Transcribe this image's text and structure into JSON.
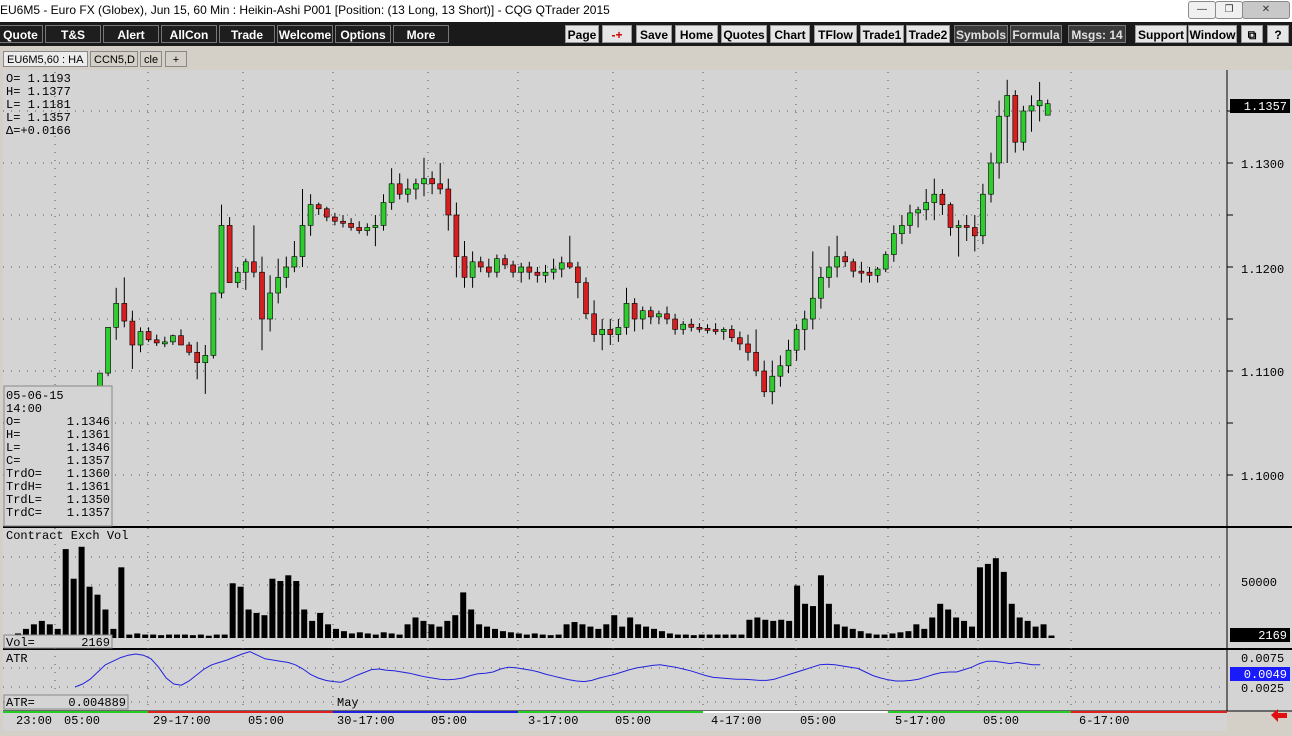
{
  "window": {
    "title": "EU6M5 - Euro FX (Globex), Jun 15, 60 Min : Heikin-Ashi   P001   [Position: (13 Long, 13 Short)] - CQG QTrader 2015"
  },
  "toolbar": {
    "left": [
      "Quote",
      "T&S",
      "Alert",
      "AllCon",
      "Trade",
      "Welcome",
      "Options",
      "More"
    ],
    "right": [
      "Page",
      "-+",
      "Save",
      "Home",
      "Quotes",
      "Chart",
      "TFlow",
      "Trade1",
      "Trade2",
      "Symbols",
      "Formula",
      "Msgs: 14",
      "Support",
      "Window",
      "⧉",
      "?"
    ]
  },
  "tabs": [
    "EU6M5,60 : HA",
    "CCN5,D",
    "cle",
    "+"
  ],
  "ohlc_box": {
    "o": "O=  1.1193",
    "h": "H=  1.1377",
    "l": "L=  1.1181",
    "c": "L=  1.1357",
    "d": "Δ=+0.0166"
  },
  "cursor_box": {
    "date": "05-06-15",
    "time": "14:00",
    "rows": [
      {
        "k": "O=",
        "v": "1.1346"
      },
      {
        "k": "H=",
        "v": "1.1361"
      },
      {
        "k": "L=",
        "v": "1.1346"
      },
      {
        "k": "C=",
        "v": "1.1357"
      },
      {
        "k": "TrdO=",
        "v": "1.1360"
      },
      {
        "k": "TrdH=",
        "v": "1.1361"
      },
      {
        "k": "TrdL=",
        "v": "1.1350"
      },
      {
        "k": "TrdC=",
        "v": "1.1357"
      }
    ]
  },
  "price_axis": {
    "labels": [
      "1.1300",
      "1.1200",
      "1.1100",
      "1.1000"
    ],
    "current": "1.1357"
  },
  "volume": {
    "title": "Contract Exch Vol",
    "label": "Vol=",
    "value": "2169",
    "axis_label": "50000",
    "current": "2169"
  },
  "atr": {
    "title": "ATR",
    "label": "ATR=",
    "value": "0.004889",
    "axis_labels": [
      "0.0075",
      "0.0025"
    ],
    "current": "0.0049"
  },
  "time_axis": {
    "labels": [
      "23:00",
      "05:00",
      "29-17:00",
      "05:00",
      "30-17:00",
      "05:00",
      "3-17:00",
      "05:00",
      "4-17:00",
      "05:00",
      "5-17:00",
      "05:00",
      "6-17:00"
    ],
    "month": "May"
  },
  "colors": {
    "up": "#2ecc2e",
    "down": "#d42020",
    "atr_line": "#2222dd",
    "bg": "#d4d4d4"
  },
  "chart_data": [
    {
      "type": "candlestick",
      "title": "",
      "ylim": [
        1.0985,
        1.1395
      ],
      "x_labels": [
        "23:00",
        "05:00",
        "29-17:00",
        "05:00",
        "30-17:00",
        "05:00",
        "3-17:00",
        "05:00",
        "4-17:00",
        "05:00",
        "5-17:00",
        "05:00",
        "6-17:00"
      ],
      "candles": [
        [
          1.1078,
          1.1098,
          1.1058,
          1.1098
        ],
        [
          1.1098,
          1.1142,
          1.1095,
          1.1142
        ],
        [
          1.1142,
          1.118,
          1.113,
          1.1165
        ],
        [
          1.1165,
          1.119,
          1.1142,
          1.1148
        ],
        [
          1.1148,
          1.1158,
          1.1102,
          1.1125
        ],
        [
          1.1125,
          1.1142,
          1.1118,
          1.1138
        ],
        [
          1.1138,
          1.1142,
          1.1128,
          1.113
        ],
        [
          1.113,
          1.1135,
          1.1124,
          1.1127
        ],
        [
          1.1127,
          1.1133,
          1.1123,
          1.1128
        ],
        [
          1.1128,
          1.1135,
          1.1125,
          1.1134
        ],
        [
          1.1134,
          1.114,
          1.1128,
          1.1125
        ],
        [
          1.1125,
          1.1128,
          1.1115,
          1.1118
        ],
        [
          1.1118,
          1.1128,
          1.1092,
          1.1108
        ],
        [
          1.1108,
          1.1125,
          1.1078,
          1.1115
        ],
        [
          1.1115,
          1.1175,
          1.1112,
          1.1175
        ],
        [
          1.1175,
          1.126,
          1.117,
          1.124
        ],
        [
          1.124,
          1.1248,
          1.1185,
          1.1185
        ],
        [
          1.1185,
          1.12,
          1.118,
          1.1195
        ],
        [
          1.1195,
          1.1208,
          1.1178,
          1.1205
        ],
        [
          1.1205,
          1.124,
          1.119,
          1.1195
        ],
        [
          1.1195,
          1.121,
          1.112,
          1.115
        ],
        [
          1.115,
          1.1192,
          1.1138,
          1.1175
        ],
        [
          1.1175,
          1.1208,
          1.1165,
          1.119
        ],
        [
          1.119,
          1.121,
          1.118,
          1.12
        ],
        [
          1.12,
          1.1225,
          1.1195,
          1.121
        ],
        [
          1.121,
          1.1275,
          1.12,
          1.124
        ],
        [
          1.124,
          1.127,
          1.123,
          1.126
        ],
        [
          1.126,
          1.1262,
          1.125,
          1.1256
        ],
        [
          1.1256,
          1.1258,
          1.1244,
          1.1248
        ],
        [
          1.1248,
          1.1252,
          1.124,
          1.1244
        ],
        [
          1.1244,
          1.125,
          1.1238,
          1.1242
        ],
        [
          1.1242,
          1.1247,
          1.1235,
          1.1238
        ],
        [
          1.1238,
          1.1244,
          1.1232,
          1.1235
        ],
        [
          1.1235,
          1.1242,
          1.123,
          1.1238
        ],
        [
          1.1238,
          1.125,
          1.122,
          1.124
        ],
        [
          1.124,
          1.127,
          1.1235,
          1.1262
        ],
        [
          1.1262,
          1.1295,
          1.1255,
          1.128
        ],
        [
          1.128,
          1.129,
          1.1265,
          1.127
        ],
        [
          1.127,
          1.1285,
          1.1262,
          1.1275
        ],
        [
          1.1275,
          1.1285,
          1.1265,
          1.128
        ],
        [
          1.128,
          1.1305,
          1.1268,
          1.1285
        ],
        [
          1.1285,
          1.1292,
          1.127,
          1.128
        ],
        [
          1.128,
          1.13,
          1.127,
          1.1275
        ],
        [
          1.1275,
          1.1285,
          1.1235,
          1.125
        ],
        [
          1.125,
          1.1262,
          1.119,
          1.121
        ],
        [
          1.121,
          1.1225,
          1.118,
          1.119
        ],
        [
          1.119,
          1.1215,
          1.118,
          1.1205
        ],
        [
          1.1205,
          1.121,
          1.1195,
          1.12
        ],
        [
          1.12,
          1.1208,
          1.119,
          1.1195
        ],
        [
          1.1195,
          1.1212,
          1.119,
          1.1208
        ],
        [
          1.1208,
          1.1212,
          1.1198,
          1.1202
        ],
        [
          1.1202,
          1.1206,
          1.119,
          1.1195
        ],
        [
          1.1195,
          1.1204,
          1.1185,
          1.12
        ],
        [
          1.12,
          1.1205,
          1.1188,
          1.1195
        ],
        [
          1.1195,
          1.12,
          1.1185,
          1.1192
        ],
        [
          1.1192,
          1.1202,
          1.1185,
          1.1195
        ],
        [
          1.1195,
          1.1208,
          1.1188,
          1.1198
        ],
        [
          1.1198,
          1.121,
          1.119,
          1.1204
        ],
        [
          1.1204,
          1.123,
          1.1198,
          1.12
        ],
        [
          1.12,
          1.1205,
          1.117,
          1.1185
        ],
        [
          1.1185,
          1.119,
          1.115,
          1.1155
        ],
        [
          1.1155,
          1.1168,
          1.1128,
          1.1135
        ],
        [
          1.1135,
          1.115,
          1.112,
          1.114
        ],
        [
          1.114,
          1.115,
          1.1125,
          1.1135
        ],
        [
          1.1135,
          1.115,
          1.1128,
          1.1142
        ],
        [
          1.1142,
          1.118,
          1.1135,
          1.1165
        ],
        [
          1.1165,
          1.117,
          1.1138,
          1.115
        ],
        [
          1.115,
          1.1162,
          1.114,
          1.1158
        ],
        [
          1.1158,
          1.1162,
          1.1145,
          1.1152
        ],
        [
          1.1152,
          1.1158,
          1.1145,
          1.1155
        ],
        [
          1.1155,
          1.1162,
          1.1145,
          1.115
        ],
        [
          1.115,
          1.1155,
          1.1135,
          1.114
        ],
        [
          1.114,
          1.1148,
          1.1135,
          1.1145
        ],
        [
          1.1145,
          1.115,
          1.1138,
          1.1142
        ],
        [
          1.1142,
          1.1146,
          1.1137,
          1.1141
        ],
        [
          1.1141,
          1.1145,
          1.1136,
          1.114
        ],
        [
          1.114,
          1.1146,
          1.1135,
          1.1138
        ],
        [
          1.1138,
          1.1142,
          1.113,
          1.114
        ],
        [
          1.114,
          1.1144,
          1.1128,
          1.1132
        ],
        [
          1.1132,
          1.1138,
          1.112,
          1.1126
        ],
        [
          1.1126,
          1.1135,
          1.111,
          1.1118
        ],
        [
          1.1118,
          1.114,
          1.1095,
          1.11
        ],
        [
          1.11,
          1.111,
          1.1075,
          1.108
        ],
        [
          1.108,
          1.111,
          1.1068,
          1.1095
        ],
        [
          1.1095,
          1.1115,
          1.1085,
          1.1105
        ],
        [
          1.1105,
          1.113,
          1.1098,
          1.112
        ],
        [
          1.112,
          1.1145,
          1.111,
          1.114
        ],
        [
          1.114,
          1.1158,
          1.112,
          1.115
        ],
        [
          1.115,
          1.1215,
          1.114,
          1.117
        ],
        [
          1.117,
          1.12,
          1.116,
          1.119
        ],
        [
          1.119,
          1.122,
          1.118,
          1.12
        ],
        [
          1.12,
          1.123,
          1.119,
          1.121
        ],
        [
          1.121,
          1.1215,
          1.12,
          1.1205
        ],
        [
          1.1205,
          1.1208,
          1.119,
          1.1196
        ],
        [
          1.1196,
          1.1205,
          1.1185,
          1.1195
        ],
        [
          1.1195,
          1.12,
          1.1185,
          1.1192
        ],
        [
          1.1192,
          1.12,
          1.1185,
          1.1198
        ],
        [
          1.1198,
          1.1215,
          1.1195,
          1.1212
        ],
        [
          1.1212,
          1.124,
          1.1205,
          1.1232
        ],
        [
          1.1232,
          1.125,
          1.1222,
          1.124
        ],
        [
          1.124,
          1.126,
          1.1232,
          1.1252
        ],
        [
          1.1252,
          1.1258,
          1.1238,
          1.1255
        ],
        [
          1.1255,
          1.1275,
          1.1245,
          1.1262
        ],
        [
          1.1262,
          1.1285,
          1.1245,
          1.127
        ],
        [
          1.127,
          1.1275,
          1.125,
          1.126
        ],
        [
          1.126,
          1.1262,
          1.123,
          1.1238
        ],
        [
          1.1238,
          1.1245,
          1.121,
          1.124
        ],
        [
          1.124,
          1.125,
          1.1225,
          1.1238
        ],
        [
          1.1238,
          1.125,
          1.1215,
          1.123
        ],
        [
          1.123,
          1.128,
          1.1222,
          1.127
        ],
        [
          1.127,
          1.131,
          1.1262,
          1.13
        ],
        [
          1.13,
          1.136,
          1.1285,
          1.1345
        ],
        [
          1.1345,
          1.138,
          1.13,
          1.1365
        ],
        [
          1.1365,
          1.137,
          1.131,
          1.132
        ],
        [
          1.132,
          1.1355,
          1.1312,
          1.135
        ],
        [
          1.135,
          1.1365,
          1.133,
          1.1355
        ],
        [
          1.1355,
          1.1378,
          1.134,
          1.136
        ],
        [
          1.1346,
          1.1361,
          1.1346,
          1.1357
        ]
      ]
    },
    {
      "type": "bar",
      "title": "Contract Exch Vol",
      "ylim": [
        0,
        100000
      ],
      "values": [
        4000,
        8000,
        12000,
        15000,
        12000,
        8000,
        78000,
        52000,
        80000,
        45000,
        38000,
        25000,
        8000,
        62000,
        3000,
        4000,
        3000,
        3000,
        2500,
        3000,
        3000,
        3000,
        2500,
        3000,
        2000,
        3000,
        3000,
        48000,
        45000,
        25000,
        22000,
        20000,
        52000,
        50000,
        55000,
        50000,
        25000,
        15000,
        22000,
        12000,
        8000,
        6000,
        4000,
        5000,
        4000,
        3000,
        5000,
        4000,
        3000,
        12000,
        18000,
        15000,
        12000,
        10000,
        15000,
        20000,
        40000,
        25000,
        12000,
        10000,
        8000,
        6000,
        5000,
        4000,
        3000,
        4000,
        3000,
        2500,
        3000,
        12000,
        14000,
        12000,
        10000,
        8000,
        12000,
        20000,
        10000,
        18000,
        12000,
        10000,
        8000,
        6000,
        4000,
        3000,
        3000,
        2500,
        3000,
        3000,
        3000,
        3000,
        3000,
        3000,
        16000,
        18000,
        16000,
        15000,
        16000,
        15000,
        46000,
        30000,
        28000,
        55000,
        30000,
        12000,
        10000,
        8000,
        6000,
        4000,
        3000,
        3000,
        4000,
        5000,
        6000,
        12000,
        8000,
        18000,
        30000,
        25000,
        18000,
        15000,
        10000,
        62000,
        65000,
        70000,
        58000,
        30000,
        18000,
        15000,
        10000,
        12000,
        2169
      ]
    },
    {
      "type": "line",
      "title": "ATR",
      "ylim": [
        0.0,
        0.01
      ],
      "values": [
        0.0025,
        0.003,
        0.0038,
        0.005,
        0.0062,
        0.0068,
        0.0074,
        0.0078,
        0.008,
        0.0078,
        0.0072,
        0.0058,
        0.004,
        0.003,
        0.0028,
        0.0035,
        0.0045,
        0.0055,
        0.0062,
        0.0066,
        0.007,
        0.0075,
        0.008,
        0.0084,
        0.0078,
        0.0072,
        0.007,
        0.0068,
        0.0066,
        0.0062,
        0.0055,
        0.0046,
        0.004,
        0.0036,
        0.0034,
        0.0033,
        0.0038,
        0.0044,
        0.0049,
        0.0054,
        0.0055,
        0.0053,
        0.0052,
        0.005,
        0.0048,
        0.0045,
        0.0042,
        0.004,
        0.0038,
        0.0037,
        0.0038,
        0.004,
        0.0044,
        0.0047,
        0.0048,
        0.005,
        0.0055,
        0.0058,
        0.0057,
        0.0055,
        0.0053,
        0.005,
        0.0046,
        0.0043,
        0.004,
        0.0037,
        0.0035,
        0.0034,
        0.0036,
        0.004,
        0.0043,
        0.0046,
        0.005,
        0.0054,
        0.0057,
        0.0059,
        0.0061,
        0.0062,
        0.006,
        0.0058,
        0.0055,
        0.0052,
        0.0048,
        0.0044,
        0.0041,
        0.004,
        0.0039,
        0.0038,
        0.0038,
        0.0037,
        0.0036,
        0.0036,
        0.0038,
        0.0042,
        0.0046,
        0.005,
        0.0054,
        0.0058,
        0.0062,
        0.0063,
        0.0062,
        0.006,
        0.0058,
        0.0056,
        0.005,
        0.0044,
        0.004,
        0.0037,
        0.0035,
        0.0035,
        0.0036,
        0.0038,
        0.0042,
        0.0046,
        0.0049,
        0.005,
        0.005,
        0.0054,
        0.0058,
        0.0064,
        0.0068,
        0.0068,
        0.0066,
        0.0064,
        0.0066,
        0.0064,
        0.0062,
        0.0062
      ]
    }
  ]
}
